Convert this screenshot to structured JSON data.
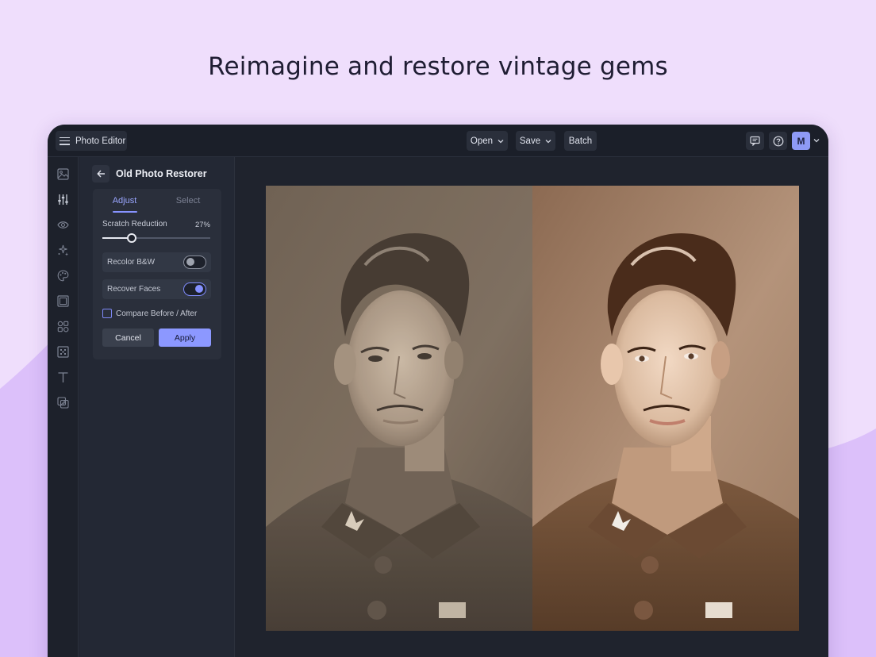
{
  "headline": "Reimagine and restore vintage gems",
  "topbar": {
    "app_label": "Photo Editor",
    "menus": [
      {
        "label": "Open",
        "icon": "chevron-down-icon"
      },
      {
        "label": "Save",
        "icon": "chevron-down-icon"
      },
      {
        "label": "Batch"
      }
    ],
    "right_icons": [
      "comment-icon",
      "help-icon"
    ],
    "avatar_initial": "M"
  },
  "rail": {
    "icons": [
      "image-icon",
      "adjust-sliders-icon",
      "eye-icon",
      "magic-sparkle-icon",
      "palette-icon",
      "frame-icon",
      "elements-icon",
      "texture-icon",
      "text-icon",
      "overlay-icon"
    ],
    "active_index": 1
  },
  "panel": {
    "title": "Old Photo Restorer",
    "tabs": [
      {
        "label": "Adjust",
        "active": true
      },
      {
        "label": "Select",
        "active": false
      }
    ],
    "scratch": {
      "label": "Scratch Reduction",
      "value_text": "27%",
      "value": 0.27
    },
    "toggles": [
      {
        "label": "Recolor B&W",
        "on": false
      },
      {
        "label": "Recover Faces",
        "on": true
      }
    ],
    "compare": {
      "label": "Compare Before / After",
      "checked": false
    },
    "cancel_label": "Cancel",
    "apply_label": "Apply"
  },
  "colors": {
    "accent": "#8c98ff",
    "page_bg": "#efdefc",
    "window_bg": "#1f232e"
  }
}
